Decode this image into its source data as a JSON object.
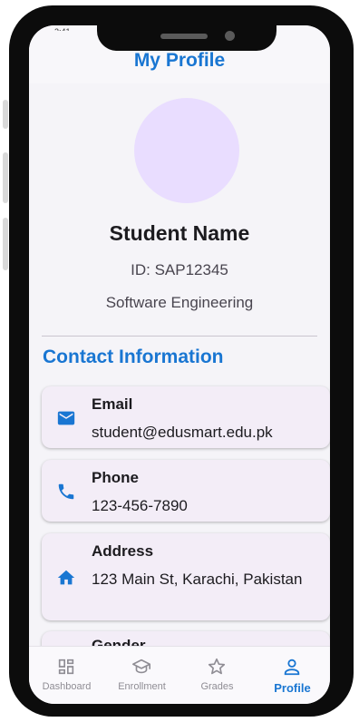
{
  "status": {
    "time": "2:41"
  },
  "appbar": {
    "title": "My Profile"
  },
  "profile": {
    "name": "Student Name",
    "id_text": "ID: SAP12345",
    "department": "Software Engineering"
  },
  "contact": {
    "section_title": "Contact Information",
    "items": [
      {
        "icon": "email-icon",
        "label": "Email",
        "value": "student@edusmart.edu.pk"
      },
      {
        "icon": "phone-icon",
        "label": "Phone",
        "value": "123-456-7890"
      },
      {
        "icon": "home-icon",
        "label": "Address",
        "value": "123 Main St, Karachi, Pakistan"
      },
      {
        "icon": "",
        "label": "Gender",
        "value": ""
      }
    ]
  },
  "bottom_nav": {
    "items": [
      {
        "label": "Dashboard",
        "icon": "dashboard-icon",
        "active": false
      },
      {
        "label": "Enrollment",
        "icon": "school-icon",
        "active": false
      },
      {
        "label": "Grades",
        "icon": "star-icon",
        "active": false
      },
      {
        "label": "Profile",
        "icon": "person-icon",
        "active": true
      }
    ]
  },
  "colors": {
    "accent": "#1976d2",
    "avatar": "#e9ddff",
    "card": "#f3edf7",
    "screen_bg": "#f5f4f8",
    "inactive_nav": "#8f8d94"
  }
}
